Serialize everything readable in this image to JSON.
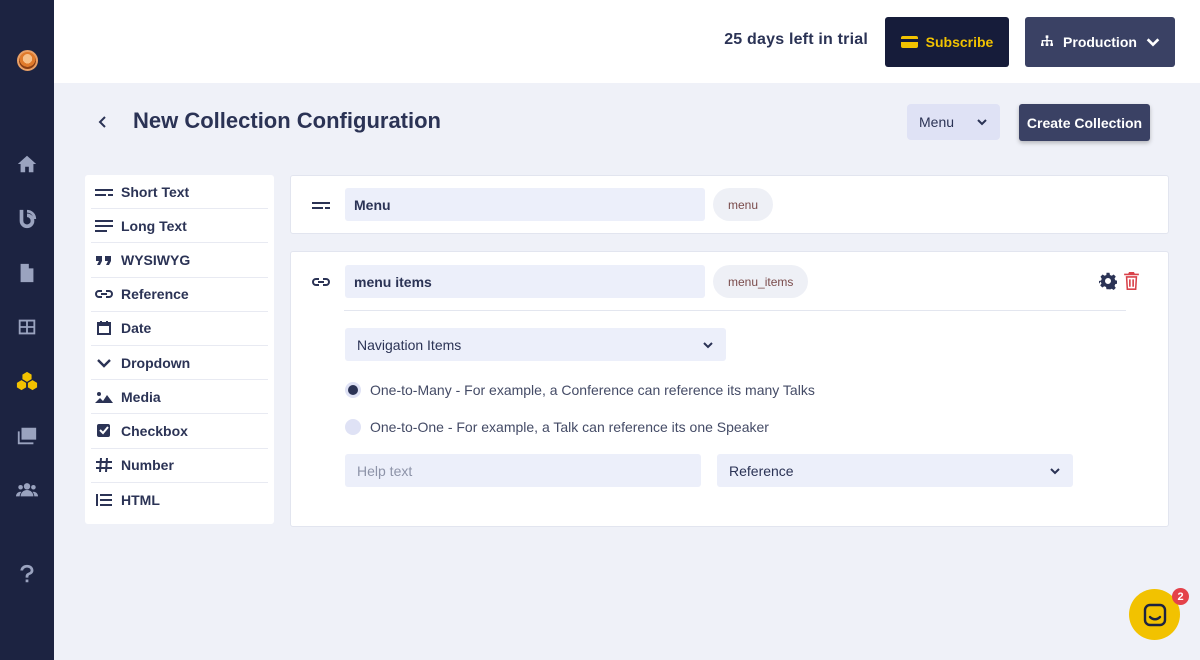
{
  "header": {
    "trial_text": "25 days left in trial",
    "subscribe_label": "Subscribe",
    "environment_label": "Production"
  },
  "page": {
    "title": "New Collection Configuration",
    "collection_select": "Menu",
    "create_label": "Create Collection"
  },
  "field_types": [
    {
      "label": "Short Text",
      "icon": "short-text-icon"
    },
    {
      "label": "Long Text",
      "icon": "long-text-icon"
    },
    {
      "label": "WYSIWYG",
      "icon": "quote-icon"
    },
    {
      "label": "Reference",
      "icon": "link-icon"
    },
    {
      "label": "Date",
      "icon": "calendar-icon"
    },
    {
      "label": "Dropdown",
      "icon": "chevron-down-icon"
    },
    {
      "label": "Media",
      "icon": "image-icon"
    },
    {
      "label": "Checkbox",
      "icon": "checkbox-icon"
    },
    {
      "label": "Number",
      "icon": "hash-icon"
    },
    {
      "label": "HTML",
      "icon": "list-icon"
    }
  ],
  "fields": {
    "title_field": {
      "name": "Menu",
      "api_id": "menu"
    },
    "reference_field": {
      "name": "menu items",
      "api_id": "menu_items",
      "collection": "Navigation Items",
      "options": [
        {
          "label": "One-to-Many - For example, a Conference can reference its many Talks",
          "selected": true
        },
        {
          "label": "One-to-One - For example, a Talk can reference its one Speaker",
          "selected": false
        }
      ],
      "help_placeholder": "Help text",
      "type_select": "Reference"
    }
  },
  "chat": {
    "badge_count": "2"
  },
  "colors": {
    "sidebar": "#1c2341",
    "accent_yellow": "#f2c200",
    "primary_button": "#3a4164",
    "danger": "#d9424a"
  }
}
